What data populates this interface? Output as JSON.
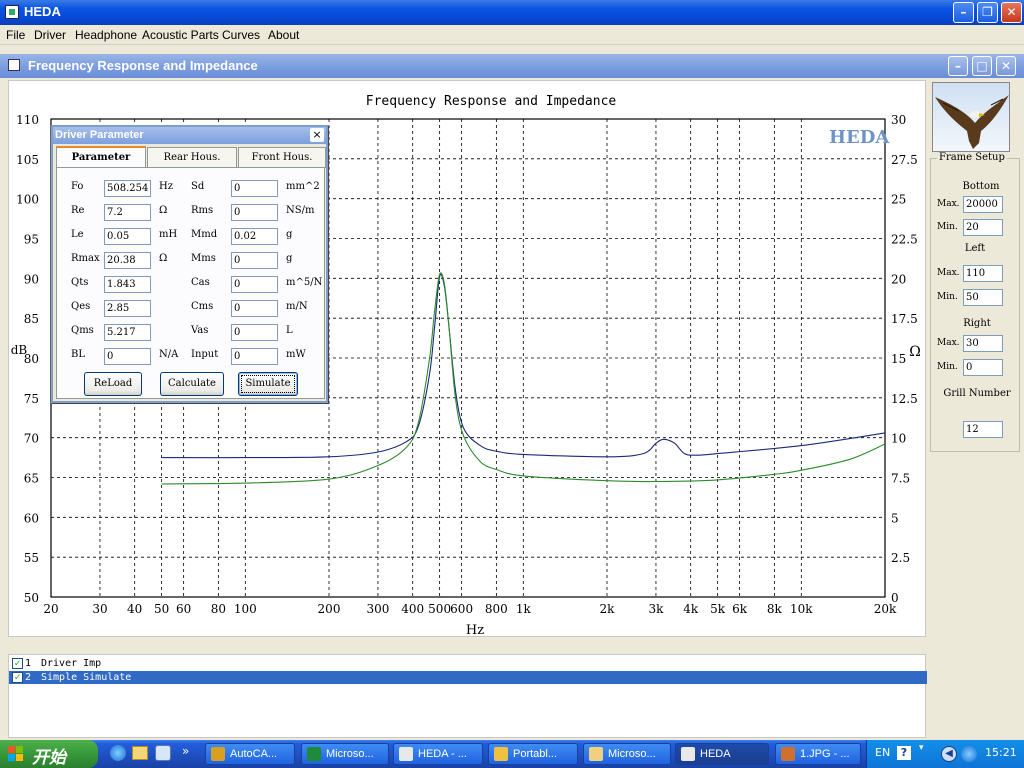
{
  "app": {
    "title": "HEDA",
    "menu": [
      "File",
      "Driver",
      "Headphone",
      "Acoustic Parts",
      "Curves",
      "About"
    ]
  },
  "child_window": {
    "title": "Frequency Response and Impedance"
  },
  "chart_data": {
    "type": "line",
    "title": "Frequency Response and Impedance",
    "brand": "HEDA",
    "xlabel": "Hz",
    "ylabel_left": "dB",
    "ylabel_right": "Ω",
    "x_scale": "log",
    "xlim": [
      20,
      20000
    ],
    "ylim_left": [
      50,
      110
    ],
    "ylim_right": [
      0,
      30
    ],
    "grid": true,
    "x_ticks": [
      20,
      30,
      40,
      50,
      60,
      80,
      100,
      200,
      300,
      400,
      500,
      600,
      800,
      1000,
      2000,
      3000,
      4000,
      5000,
      6000,
      8000,
      10000,
      20000
    ],
    "x_tick_labels": [
      "20",
      "30",
      "40",
      "50",
      "60",
      "80",
      "100",
      "200",
      "300",
      "400",
      "500",
      "600",
      "800",
      "1k",
      "2k",
      "3k",
      "4k",
      "5k",
      "6k",
      "8k",
      "10k",
      "20k"
    ],
    "y_left_ticks": [
      "50",
      "55",
      "60",
      "65",
      "70",
      "75",
      "80",
      "85",
      "90",
      "95",
      "100",
      "105",
      "110"
    ],
    "y_right_ticks": [
      "0",
      "2.5",
      "5",
      "7.5",
      "10",
      "12.5",
      "15",
      "17.5",
      "20",
      "22.5",
      "25",
      "27.5",
      "30"
    ],
    "series": [
      {
        "color": "#1a2a78",
        "axis": "left",
        "x": [
          50,
          100,
          200,
          300,
          380,
          420,
          460,
          480,
          500,
          520,
          540,
          570,
          610,
          700,
          800,
          1000,
          2000,
          2700,
          3000,
          3200,
          3500,
          3800,
          4200,
          5000,
          10000,
          20000
        ],
        "y": [
          67.5,
          67.5,
          67.6,
          68.2,
          69.5,
          71.5,
          78,
          84,
          90.2,
          89,
          84,
          76,
          71.2,
          69,
          68.3,
          67.9,
          67.6,
          68,
          69.3,
          69.8,
          69.3,
          68,
          67.8,
          68,
          69,
          70.6
        ]
      },
      {
        "color": "#2f8a2f",
        "axis": "left",
        "x": [
          50,
          100,
          200,
          300,
          380,
          420,
          460,
          480,
          500,
          520,
          540,
          570,
          610,
          700,
          800,
          1000,
          2000,
          3000,
          5000,
          8000,
          10000,
          15000,
          20000
        ],
        "y": [
          64.2,
          64.3,
          64.8,
          66.5,
          68.8,
          72,
          80,
          86,
          90.5,
          89.3,
          84,
          75,
          70.2,
          67,
          66,
          65.2,
          64.6,
          64.5,
          64.7,
          65.4,
          65.9,
          67.3,
          69.2
        ]
      }
    ]
  },
  "driver_parameter": {
    "title": "Driver Parameter",
    "close_glyph": "×",
    "tabs": [
      "Parameter",
      "Rear Hous.",
      "Front Hous."
    ],
    "params": [
      {
        "name": "Fo",
        "value": "508.254",
        "unit": "Hz"
      },
      {
        "name": "Re",
        "value": "7.2",
        "unit": "Ω"
      },
      {
        "name": "Le",
        "value": "0.05",
        "unit": "mH"
      },
      {
        "name": "Rmax",
        "value": "20.38",
        "unit": "Ω"
      },
      {
        "name": "Qts",
        "value": "1.843",
        "unit": ""
      },
      {
        "name": "Qes",
        "value": "2.85",
        "unit": ""
      },
      {
        "name": "Qms",
        "value": "5.217",
        "unit": ""
      },
      {
        "name": "BL",
        "value": "0",
        "unit": "N/A"
      }
    ],
    "params2": [
      {
        "name": "Sd",
        "value": "0",
        "unit": "mm^2"
      },
      {
        "name": "Rms",
        "value": "0",
        "unit": "NS/m"
      },
      {
        "name": "Mmd",
        "value": "0.02",
        "unit": "g"
      },
      {
        "name": "Mms",
        "value": "0",
        "unit": "g"
      },
      {
        "name": "Cas",
        "value": "0",
        "unit": "m^5/N"
      },
      {
        "name": "Cms",
        "value": "0",
        "unit": "m/N"
      },
      {
        "name": "Vas",
        "value": "0",
        "unit": "L"
      },
      {
        "name": "Input",
        "value": "0",
        "unit": "mW"
      }
    ],
    "buttons": [
      "ReLoad",
      "Calculate",
      "Simulate"
    ]
  },
  "frame_setup": {
    "title": "Frame Setup",
    "bottom_label": "Bottom",
    "left_label": "Left",
    "right_label": "Right",
    "max_label": "Max.",
    "min_label": "Min.",
    "bottom_max": "20000",
    "bottom_min": "20",
    "left_max": "110",
    "left_min": "50",
    "right_max": "30",
    "right_min": "0",
    "grill_label": "Grill Number",
    "grill_number": "12"
  },
  "curves": [
    {
      "checked": true,
      "index": "1",
      "name": "Driver Imp",
      "selected": false
    },
    {
      "checked": true,
      "index": "2",
      "name": "Simple Simulate",
      "selected": true
    }
  ],
  "taskbar": {
    "start": "开始",
    "quick_launch_more": "»",
    "buttons": [
      {
        "label": "AutoCA...",
        "active": false,
        "icon_color": "#d8a020"
      },
      {
        "label": "Microso...",
        "active": false,
        "icon_color": "#1f8a3a"
      },
      {
        "label": "HEDA - ...",
        "active": false,
        "icon_color": "#e8e8e8"
      },
      {
        "label": "Portabl...",
        "active": false,
        "icon_color": "#f0c040"
      },
      {
        "label": "Microso...",
        "active": false,
        "icon_color": "#f0d080"
      },
      {
        "label": "HEDA",
        "active": true,
        "icon_color": "#e8e8e8"
      },
      {
        "label": "1.JPG - ...",
        "active": false,
        "icon_color": "#d07030"
      }
    ],
    "lang": "EN",
    "clock": "15:21"
  }
}
